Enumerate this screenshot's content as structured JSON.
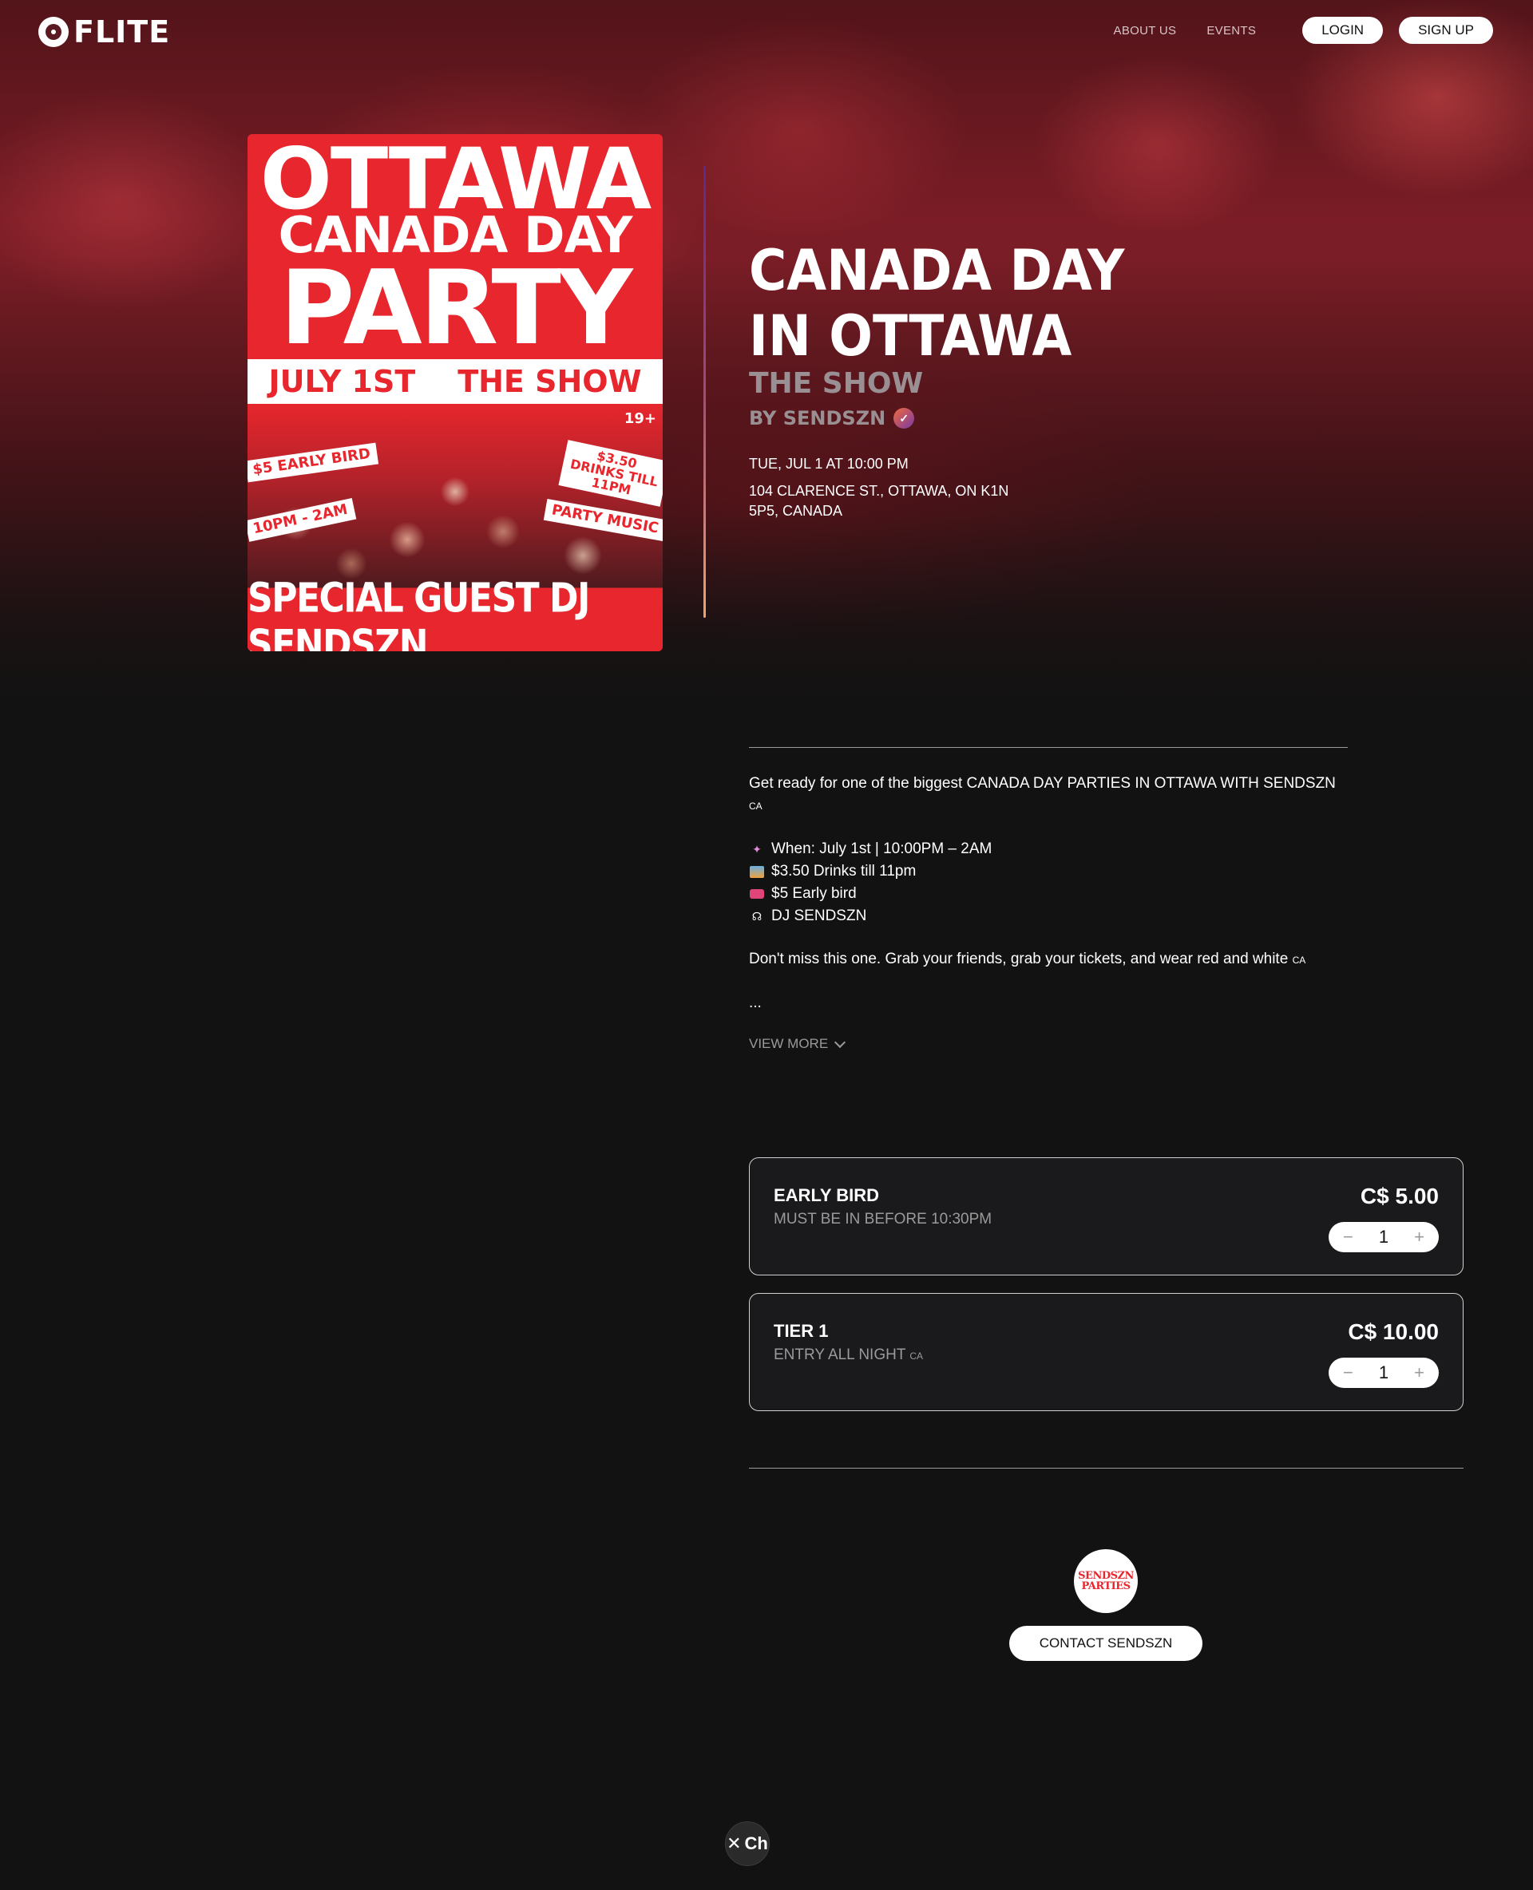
{
  "nav": {
    "logo": "FLITE",
    "links": [
      "ABOUT US",
      "EVENTS"
    ],
    "login": "LOGIN",
    "signup": "SIGN UP"
  },
  "poster": {
    "line1": "OTTAWA",
    "line2": "CANADA DAY",
    "line3": "PARTY",
    "band_left": "JULY 1ST",
    "band_right": "THE SHOW",
    "age": "19+",
    "tag_early": "$5 EARLY BIRD",
    "tag_time": "10PM - 2AM",
    "tag_drinks": "$3.50 DRINKS TILL 11PM",
    "tag_music": "PARTY MUSIC",
    "guest": "SPECIAL GUEST DJ SENDSZN"
  },
  "event": {
    "title": "CANADA DAY IN OTTAWA",
    "venue": "THE SHOW",
    "organizer": "BY SENDSZN",
    "date": "TUE, JUL 1 AT 10:00 PM",
    "address": "104 CLARENCE ST., OTTAWA, ON K1N 5P5, CANADA"
  },
  "description": {
    "intro": "Get ready for one of the biggest CANADA DAY PARTIES IN OTTAWA WITH SENDSZN",
    "intro_flag": "CA",
    "items": [
      {
        "icon": "party-popper-icon",
        "text": "When: July 1st | 10:00PM – 2AM"
      },
      {
        "icon": "picture-icon",
        "text": "$3.50 Drinks till 11pm"
      },
      {
        "icon": "ticket-icon",
        "text": "$5 Early bird"
      },
      {
        "icon": "headphones-icon",
        "text": "DJ SENDSZN"
      }
    ],
    "outro": "Don't miss this one. Grab your friends, grab your tickets, and wear red and white",
    "outro_flag": "CA",
    "ellipsis": "...",
    "view_more": "VIEW MORE"
  },
  "tickets": [
    {
      "name": "EARLY BIRD",
      "desc": "MUST BE IN BEFORE 10:30PM",
      "desc_flag": "",
      "price": "C$ 5.00",
      "qty": "1"
    },
    {
      "name": "TIER 1",
      "desc": "ENTRY ALL NIGHT",
      "desc_flag": "CA",
      "price": "C$ 10.00",
      "qty": "1"
    }
  ],
  "stepper": {
    "minus": "−",
    "plus": "+"
  },
  "organizer_card": {
    "avatar_line1": "SENDSZN",
    "avatar_line2": "PARTIES",
    "contact": "CONTACT SENDSZN"
  },
  "chat": {
    "close": "✕",
    "label": "Ch"
  }
}
